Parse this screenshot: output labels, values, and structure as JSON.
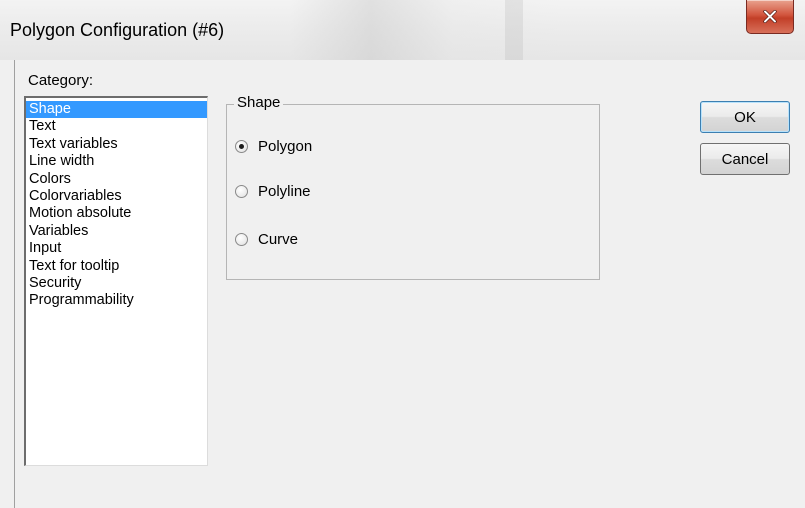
{
  "window": {
    "title": "Polygon Configuration (#6)",
    "close_icon": "close-icon",
    "close_color": "#c7432d"
  },
  "category": {
    "label": "Category:",
    "selected_index": 0,
    "selection_color": "#3399ff",
    "items": [
      {
        "label": "Shape"
      },
      {
        "label": "Text"
      },
      {
        "label": "Text variables"
      },
      {
        "label": "Line width"
      },
      {
        "label": "Colors"
      },
      {
        "label": "Colorvariables"
      },
      {
        "label": "Motion absolute"
      },
      {
        "label": "Variables"
      },
      {
        "label": "Input"
      },
      {
        "label": "Text for tooltip"
      },
      {
        "label": "Security"
      },
      {
        "label": "Programmability"
      }
    ]
  },
  "shape_group": {
    "title": "Shape",
    "options": [
      {
        "label": "Polygon",
        "checked": true
      },
      {
        "label": "Polyline",
        "checked": false
      },
      {
        "label": "Curve",
        "checked": false
      }
    ]
  },
  "buttons": {
    "ok_label": "OK",
    "cancel_label": "Cancel"
  }
}
